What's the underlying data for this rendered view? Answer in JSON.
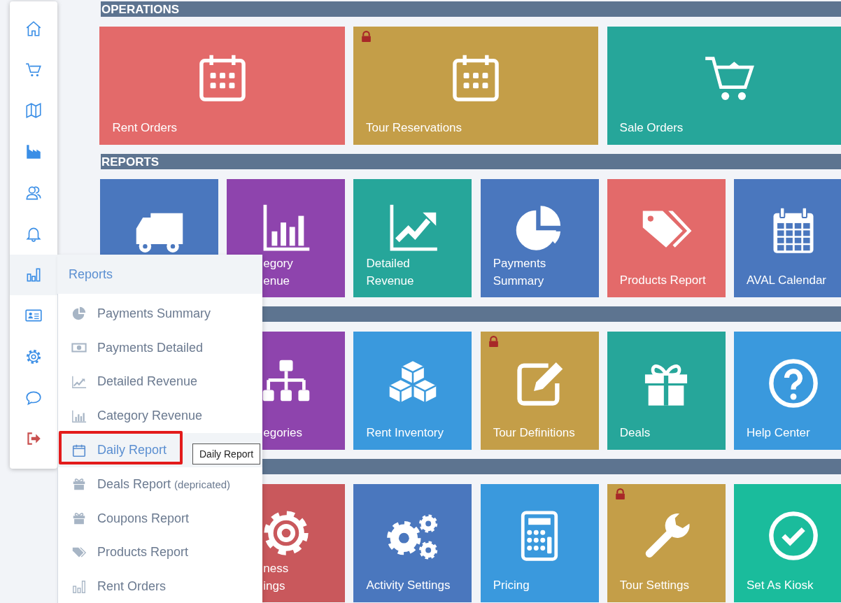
{
  "sidebar": {
    "items": [
      {
        "kind": "home",
        "selected": false
      },
      {
        "kind": "cart",
        "selected": false
      },
      {
        "kind": "map",
        "selected": false
      },
      {
        "kind": "factory",
        "selected": false
      },
      {
        "kind": "users",
        "selected": false
      },
      {
        "kind": "bell",
        "selected": false
      },
      {
        "kind": "reports",
        "selected": true
      },
      {
        "kind": "idcard",
        "selected": false
      },
      {
        "kind": "gear",
        "selected": false
      },
      {
        "kind": "chat",
        "selected": false
      },
      {
        "kind": "logout",
        "selected": false
      }
    ]
  },
  "flyout": {
    "title": "Reports",
    "items": [
      {
        "kind": "pie",
        "label": "Payments Summary",
        "selected": false,
        "framed": false
      },
      {
        "kind": "money",
        "label": "Payments Detailed",
        "selected": false,
        "framed": false
      },
      {
        "kind": "line",
        "label": "Detailed Revenue",
        "selected": false,
        "framed": false
      },
      {
        "kind": "bars",
        "label": "Category Revenue",
        "selected": false,
        "framed": false
      },
      {
        "kind": "calendar",
        "label": "Daily Report",
        "selected": true,
        "framed": true
      },
      {
        "kind": "gift",
        "label": "Deals Report",
        "note": "(depricated)",
        "selected": false,
        "framed": false
      },
      {
        "kind": "gift",
        "label": "Coupons Report",
        "selected": false,
        "framed": false
      },
      {
        "kind": "tag",
        "label": "Products Report",
        "selected": false,
        "framed": false
      },
      {
        "kind": "columns",
        "label": "Rent Orders",
        "selected": false,
        "framed": false
      }
    ]
  },
  "tooltip": "Daily Report",
  "sections": [
    {
      "title": "OPERATIONS",
      "tiles": [
        {
          "kind": "calendar",
          "lines": [
            "Rent Orders"
          ],
          "color": "#e36a6a",
          "locked": false,
          "partial": false
        },
        {
          "kind": "calendar",
          "lines": [
            "Tour Reservations"
          ],
          "color": "#c49e48",
          "locked": true,
          "partial": false
        },
        {
          "kind": "cart",
          "lines": [
            "Sale Orders"
          ],
          "color": "#26a69a",
          "locked": false,
          "partial": false
        }
      ]
    },
    {
      "title": "REPORTS",
      "tiles": [
        {
          "kind": "truck",
          "color": "#4a77be",
          "locked": false
        },
        {
          "kind": "bars",
          "lines": [
            "egory",
            "enue"
          ],
          "color": "#8e44ad",
          "locked": false,
          "partial": true
        },
        {
          "kind": "line",
          "lines": [
            "Detailed",
            "Revenue"
          ],
          "color": "#26a69a",
          "locked": false,
          "partial": false
        },
        {
          "kind": "pie",
          "lines": [
            "Payments",
            "Summary"
          ],
          "color": "#4a77be",
          "locked": false,
          "partial": false
        },
        {
          "kind": "tags",
          "lines": [
            "Products Report"
          ],
          "color": "#e36a6a",
          "locked": false,
          "partial": false
        },
        {
          "kind": "calgrid",
          "lines": [
            "AVAL Calendar"
          ],
          "color": "#4a77be",
          "locked": false,
          "partial": false
        }
      ]
    },
    {
      "tiles": [
        {
          "kind": "org",
          "lines": [
            "egories"
          ],
          "color": "#8e44ad",
          "locked": false,
          "partial": true
        },
        {
          "kind": "cubes",
          "lines": [
            "Rent Inventory"
          ],
          "color": "#3a99dd",
          "locked": false,
          "partial": false
        },
        {
          "kind": "edit",
          "lines": [
            "Tour Definitions"
          ],
          "color": "#c49e48",
          "locked": true,
          "partial": false
        },
        {
          "kind": "gift",
          "lines": [
            "Deals"
          ],
          "color": "#26a69a",
          "locked": false,
          "partial": false
        },
        {
          "kind": "help",
          "lines": [
            "Help Center"
          ],
          "color": "#3a99dd",
          "locked": false,
          "partial": false
        }
      ]
    },
    {
      "tiles": [
        {
          "kind": "gear",
          "lines": [
            "ness",
            "ings"
          ],
          "color": "#c9585c",
          "locked": false,
          "partial": true
        },
        {
          "kind": "gears",
          "lines": [
            "Activity Settings"
          ],
          "color": "#4a77be",
          "locked": false,
          "partial": false
        },
        {
          "kind": "calc",
          "lines": [
            "Pricing"
          ],
          "color": "#3a99dd",
          "locked": false,
          "partial": false
        },
        {
          "kind": "wrench",
          "lines": [
            "Tour Settings"
          ],
          "color": "#c49e48",
          "locked": true,
          "partial": false
        },
        {
          "kind": "check",
          "lines": [
            "Set As Kiosk"
          ],
          "color": "#1abc9c",
          "locked": false,
          "partial": false
        }
      ]
    }
  ]
}
